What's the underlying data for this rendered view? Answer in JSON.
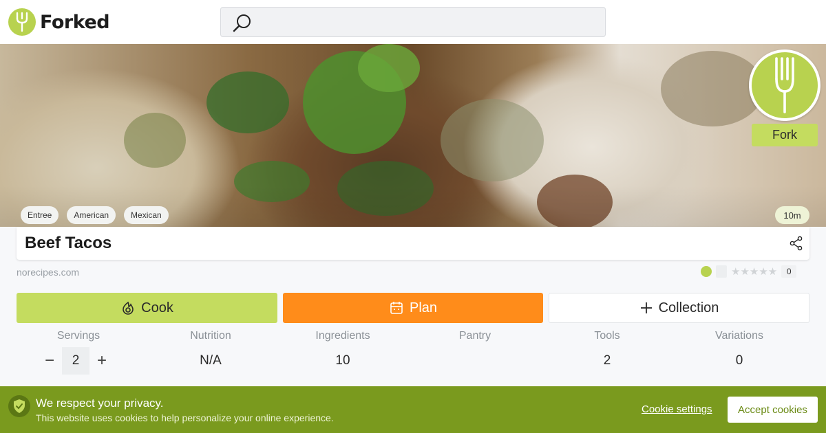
{
  "header": {
    "brand": "Forked",
    "search_placeholder": ""
  },
  "hero": {
    "fork_label": "Fork",
    "tags": [
      "Entree",
      "American",
      "Mexican"
    ],
    "time": "10m"
  },
  "recipe": {
    "title": "Beef Tacos",
    "source": "norecipes.com",
    "rating_count": "0"
  },
  "actions": {
    "cook": "Cook",
    "plan": "Plan",
    "collection": "Collection"
  },
  "stats": {
    "servings_label": "Servings",
    "servings_value": "2",
    "nutrition_label": "Nutrition",
    "nutrition_value": "N/A",
    "ingredients_label": "Ingredients",
    "ingredients_value": "10",
    "pantry_label": "Pantry",
    "pantry_value": "",
    "tools_label": "Tools",
    "tools_value": "2",
    "variations_label": "Variations",
    "variations_value": "0"
  },
  "cookie": {
    "title": "We respect your privacy.",
    "text": "This website uses cookies to help personalize your online experience.",
    "settings": "Cookie settings",
    "accept": "Accept cookies"
  },
  "colors": {
    "brand_green": "#b8d24f",
    "cook_green": "#c4dc5f",
    "plan_orange": "#ff8c1a",
    "banner_green": "#7a9a1e"
  }
}
